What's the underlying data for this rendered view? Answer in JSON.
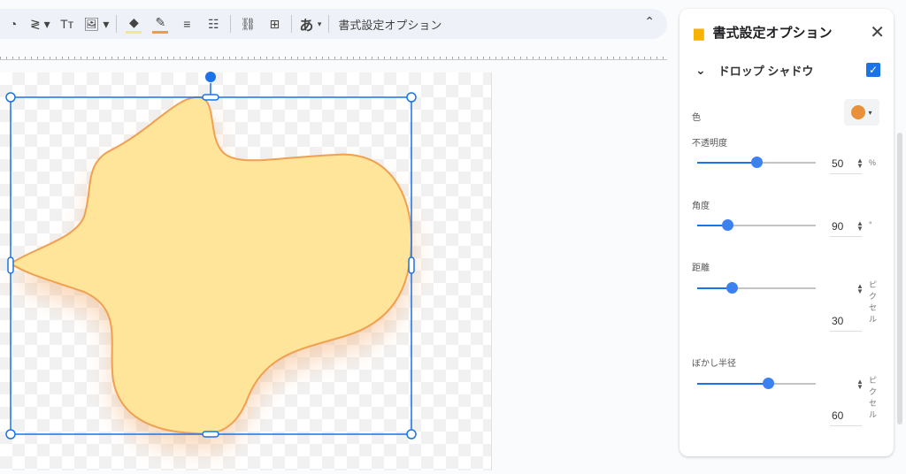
{
  "toolbar": {
    "format_options_label": "書式設定オプション",
    "font_glyph": "あ",
    "text_size_glyph": "Tт"
  },
  "panel": {
    "title": "書式設定オプション",
    "section": "ドロップ シャドウ",
    "shadow_enabled": true,
    "color_label": "色",
    "shadow_color": "#e8913a",
    "opacity": {
      "label": "不透明度",
      "value": "50",
      "unit": "%",
      "fraction": 0.5
    },
    "angle": {
      "label": "角度",
      "value": "90",
      "unit": "°",
      "fraction": 0.25
    },
    "distance": {
      "label": "距離",
      "value": "30",
      "unit": "ピクセル",
      "fraction": 0.29
    },
    "blur": {
      "label": "ぼかし半径",
      "value": "60",
      "unit": "ピクセル",
      "fraction": 0.6
    }
  },
  "colors": {
    "accent": "#1a73e8",
    "shape_fill": "#ffe59a",
    "shape_stroke": "#f0a050",
    "fill_bar": "#fde293",
    "line_bar": "#f29a4a"
  }
}
